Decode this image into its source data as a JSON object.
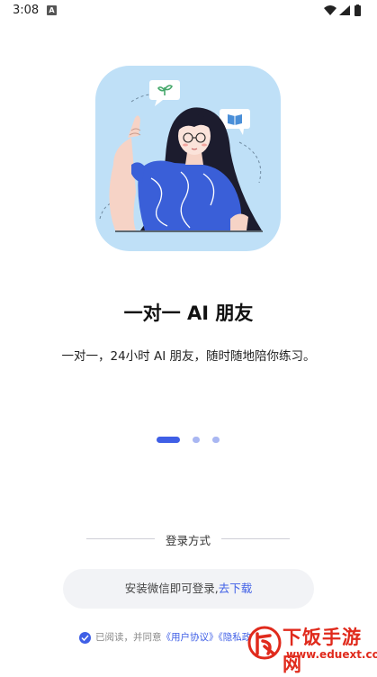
{
  "status_bar": {
    "time": "3:08",
    "notification_badge": "A",
    "icons": [
      "wifi-icon",
      "cellular-icon",
      "battery-icon"
    ]
  },
  "onboarding": {
    "title": "一对一 AI 朋友",
    "subtitle": "一对一，24小时 AI 朋友，随时随地陪你练习。",
    "page_indicator": {
      "total": 3,
      "current": 1
    }
  },
  "login": {
    "divider_label": "登录方式",
    "wechat_button": {
      "text": "安装微信即可登录,",
      "link_text": "去下载"
    }
  },
  "agreement": {
    "checked": true,
    "prefix": "已阅读，并同意",
    "user_agreement": "《用户协议》",
    "privacy_policy": "《隐私政策》"
  },
  "watermark": {
    "brand": "下饭手游网",
    "url": "www.eduext.com"
  },
  "colors": {
    "accent": "#3f5fe6",
    "illustration_bg": "#bfe0f7",
    "shirt": "#3a5fd8",
    "watermark": "#e02a1c"
  }
}
